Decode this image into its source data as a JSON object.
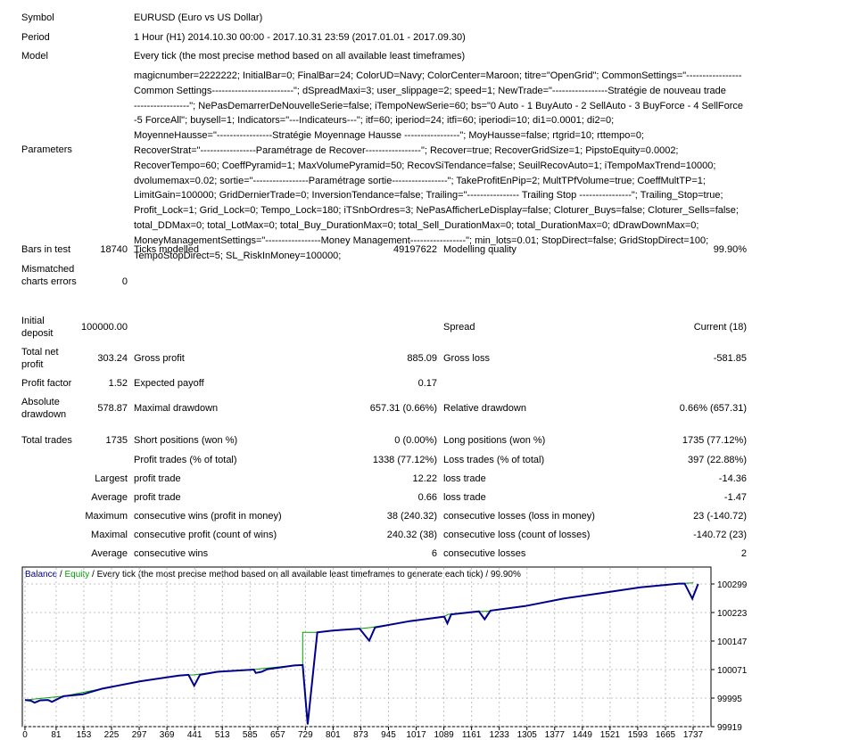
{
  "symbol": {
    "label": "Symbol",
    "value": "EURUSD (Euro vs US Dollar)"
  },
  "period": {
    "label": "Period",
    "value": "1 Hour (H1) 2014.10.30 00:00 - 2017.10.31 23:59 (2017.01.01 - 2017.09.30)"
  },
  "model": {
    "label": "Model",
    "value": "Every tick (the most precise method based on all available least timeframes)"
  },
  "parameters": {
    "label": "Parameters",
    "lines": [
      "magicnumber=2222222; InitialBar=0; FinalBar=24; ColorUD=Navy; ColorCenter=Maroon; titre=\"OpenGrid\"; CommonSettings=\"-----------------",
      "Common Settings-------------------------\"; dSpreadMaxi=3; user_slippage=2; speed=1; NewTrade=\"-----------------Stratégie de nouveau trade",
      "-----------------\"; NePasDemarrerDeNouvelleSerie=false; iTempoNewSerie=60; bs=\"0 Auto - 1 BuyAuto - 2 SellAuto - 3 BuyForce - 4 SellForce",
      "-5 ForceAll\"; buysell=1; Indicators=\"---Indicateurs---\"; itf=60; iperiod=24; itfi=60; iperiodi=10; di1=0.0001; di2=0;",
      "MoyenneHausse=\"-----------------Stratégie Moyennage Hausse -----------------\"; MoyHausse=false; rtgrid=10; rttempo=0;",
      "RecoverStrat=\"-----------------Paramétrage de Recover-----------------\"; Recover=true; RecoverGridSize=1; PipstoEquity=0.0002;",
      "RecoverTempo=60; CoeffPyramid=1; MaxVolumePyramid=50; RecovSiTendance=false; SeuilRecovAuto=1; iTempoMaxTrend=10000;",
      "dvolumemax=0.02; sortie=\"-----------------Paramétrage sortie-----------------\"; TakeProfitEnPip=2; MultTPfVolume=true; CoeffMultTP=1;",
      "LimitGain=100000; GridDernierTrade=0; InversionTendance=false; Trailing=\"---------------- Trailing Stop ----------------\"; Trailing_Stop=true;",
      "Profit_Lock=1; Grid_Lock=0; Tempo_Lock=180; iTSnbOrdres=3; NePasAfficherLeDisplay=false; Cloturer_Buys=false; Cloturer_Sells=false;",
      "total_DDMax=0; total_LotMax=0; total_Buy_DurationMax=0; total_Sell_DurationMax=0; total_DurationMax=0; dDrawDownMax=0;",
      "MoneyManagementSettings=\"-----------------Money Management-----------------\"; min_lots=0.01; StopDirect=false; GridStopDirect=100;",
      "TempoStopDirect=5; SL_RiskInMoney=100000;"
    ]
  },
  "stats": {
    "bars_label": "Bars in test",
    "bars": "18740",
    "ticks_label": "Ticks modelled",
    "ticks": "49197622",
    "quality_label": "Modelling quality",
    "quality": "99.90%",
    "mismatch_label": "Mismatched charts errors",
    "mismatch": "0",
    "deposit_label": "Initial deposit",
    "deposit": "100000.00",
    "spread_label": "Spread",
    "spread": "Current (18)",
    "net_label": "Total net profit",
    "net": "303.24",
    "gross_profit_label": "Gross profit",
    "gross_profit": "885.09",
    "gross_loss_label": "Gross loss",
    "gross_loss": "-581.85",
    "pf_label": "Profit factor",
    "pf": "1.52",
    "ep_label": "Expected payoff",
    "ep": "0.17",
    "abs_dd_label": "Absolute drawdown",
    "abs_dd": "578.87",
    "max_dd_label": "Maximal drawdown",
    "max_dd": "657.31 (0.66%)",
    "rel_dd_label": "Relative drawdown",
    "rel_dd": "0.66% (657.31)",
    "trades_label": "Total trades",
    "trades": "1735",
    "short_label": "Short positions (won %)",
    "short": "0 (0.00%)",
    "long_label": "Long positions (won %)",
    "long": "1735 (77.12%)",
    "profit_trades_label": "Profit trades (% of total)",
    "profit_trades": "1338 (77.12%)",
    "loss_trades_label": "Loss trades (% of total)",
    "loss_trades": "397 (22.88%)",
    "largest": "Largest",
    "largest_profit_label": "profit trade",
    "largest_profit": "12.22",
    "largest_loss_label": "loss trade",
    "largest_loss": "-14.36",
    "average": "Average",
    "avg_profit_label": "profit trade",
    "avg_profit": "0.66",
    "avg_loss_label": "loss trade",
    "avg_loss": "-1.47",
    "maximum": "Maximum",
    "max_wins_label": "consecutive wins (profit in money)",
    "max_wins": "38 (240.32)",
    "max_losses_label": "consecutive losses (loss in money)",
    "max_losses": "23 (-140.72)",
    "maximal": "Maximal",
    "maxl_profit_label": "consecutive profit (count of wins)",
    "maxl_profit": "240.32 (38)",
    "maxl_loss_label": "consecutive loss (count of losses)",
    "maxl_loss": "-140.72 (23)",
    "average2": "Average",
    "avg_wins_label": "consecutive wins",
    "avg_wins": "6",
    "avg_losses_label": "consecutive losses",
    "avg_losses": "2"
  },
  "chart_data": {
    "type": "line",
    "legend": {
      "balance": "Balance",
      "equity": "Equity",
      "sep": " / ",
      "desc": "Every tick (the most precise method based on all available least timeframes to generate each tick)",
      "quality": "99.90%"
    },
    "colors": {
      "balance": "#00008b",
      "equity": "#00a000",
      "grid": "#c0c0c0"
    },
    "x_ticks": [
      0,
      81,
      153,
      225,
      297,
      369,
      441,
      513,
      585,
      657,
      729,
      801,
      873,
      945,
      1017,
      1089,
      1161,
      1233,
      1305,
      1377,
      1449,
      1521,
      1593,
      1665,
      1737
    ],
    "y_ticks": [
      99919,
      99995,
      100071,
      100147,
      100223,
      100299
    ],
    "xlim": [
      0,
      1737
    ],
    "ylim": [
      99919,
      100310
    ],
    "series": [
      {
        "name": "Balance",
        "points": [
          [
            0,
            99990
          ],
          [
            100,
            100000
          ],
          [
            200,
            100020
          ],
          [
            300,
            100040
          ],
          [
            400,
            100055
          ],
          [
            440,
            100057
          ],
          [
            500,
            100065
          ],
          [
            600,
            100072
          ],
          [
            700,
            100082
          ],
          [
            722,
            100083
          ],
          [
            722,
            100170
          ],
          [
            760,
            100170
          ],
          [
            800,
            100175
          ],
          [
            870,
            100180
          ],
          [
            900,
            100183
          ],
          [
            1000,
            100200
          ],
          [
            1090,
            100212
          ],
          [
            1100,
            100218
          ],
          [
            1180,
            100226
          ],
          [
            1200,
            100226
          ],
          [
            1300,
            100240
          ],
          [
            1400,
            100260
          ],
          [
            1500,
            100275
          ],
          [
            1600,
            100290
          ],
          [
            1700,
            100300
          ],
          [
            1737,
            100302
          ]
        ]
      },
      {
        "name": "Equity",
        "points": [
          [
            0,
            99990
          ],
          [
            15,
            99988
          ],
          [
            25,
            99983
          ],
          [
            40,
            99989
          ],
          [
            60,
            99990
          ],
          [
            70,
            99985
          ],
          [
            100,
            100000
          ],
          [
            150,
            100005
          ],
          [
            200,
            100020
          ],
          [
            300,
            100040
          ],
          [
            400,
            100055
          ],
          [
            425,
            100057
          ],
          [
            440,
            100028
          ],
          [
            455,
            100057
          ],
          [
            500,
            100065
          ],
          [
            595,
            100071
          ],
          [
            600,
            100062
          ],
          [
            615,
            100065
          ],
          [
            630,
            100072
          ],
          [
            700,
            100082
          ],
          [
            722,
            100083
          ],
          [
            735,
            99925
          ],
          [
            760,
            100170
          ],
          [
            800,
            100175
          ],
          [
            870,
            100180
          ],
          [
            895,
            100148
          ],
          [
            910,
            100183
          ],
          [
            1000,
            100200
          ],
          [
            1090,
            100212
          ],
          [
            1098,
            100194
          ],
          [
            1108,
            100218
          ],
          [
            1180,
            100226
          ],
          [
            1195,
            100205
          ],
          [
            1210,
            100228
          ],
          [
            1300,
            100240
          ],
          [
            1400,
            100260
          ],
          [
            1500,
            100275
          ],
          [
            1600,
            100290
          ],
          [
            1700,
            100300
          ],
          [
            1715,
            100300
          ],
          [
            1735,
            100260
          ],
          [
            1750,
            100299
          ]
        ]
      }
    ]
  }
}
